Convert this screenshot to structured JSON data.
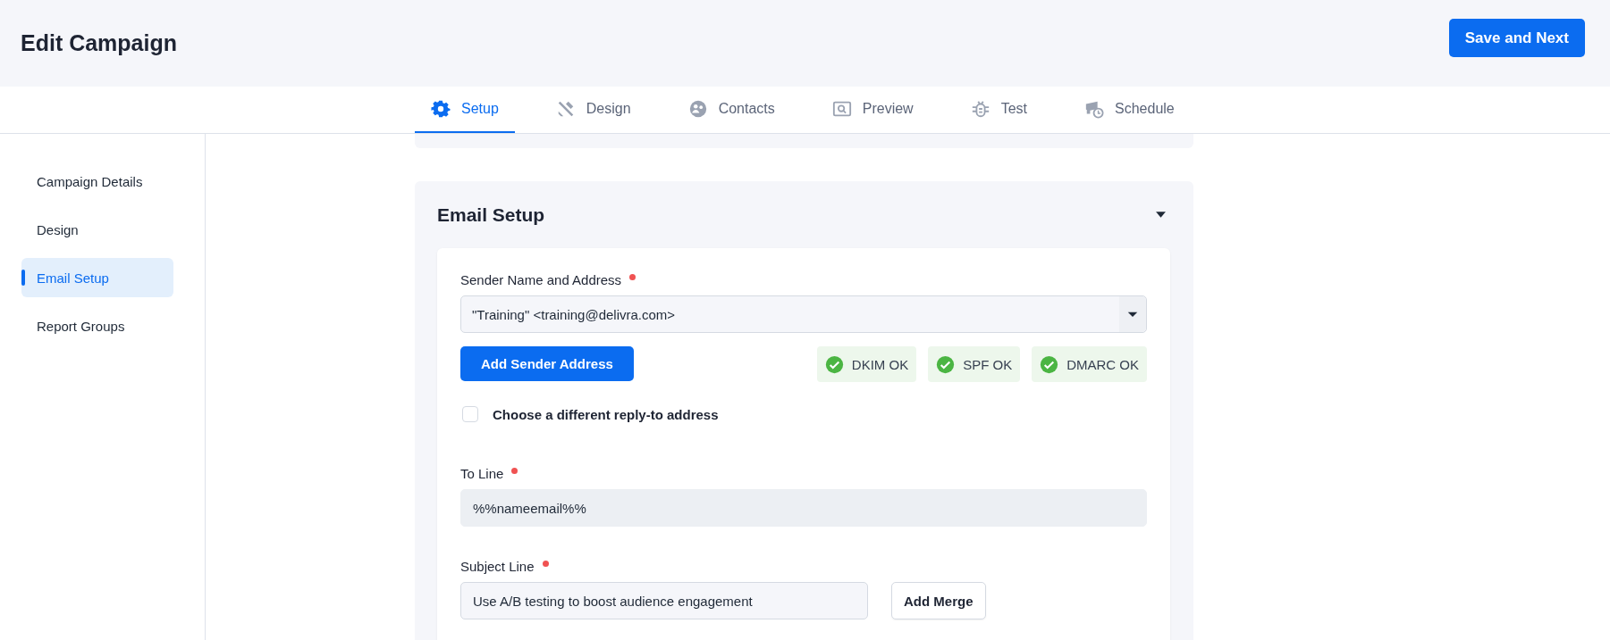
{
  "header": {
    "title": "Edit Campaign",
    "primary_button": "Save and Next"
  },
  "tabs": [
    {
      "label": "Setup",
      "kind": "gear",
      "selected": true
    },
    {
      "label": "Design",
      "kind": "tools",
      "selected": false
    },
    {
      "label": "Contacts",
      "kind": "people",
      "selected": false
    },
    {
      "label": "Preview",
      "kind": "preview",
      "selected": false
    },
    {
      "label": "Test",
      "kind": "bug",
      "selected": false
    },
    {
      "label": "Schedule",
      "kind": "schedule",
      "selected": false
    }
  ],
  "sidebar": {
    "items": [
      {
        "label": "Campaign Details",
        "selected": false
      },
      {
        "label": "Design",
        "selected": false
      },
      {
        "label": "Email Setup",
        "selected": true
      },
      {
        "label": "Report Groups",
        "selected": false
      }
    ]
  },
  "section": {
    "title": "Email Setup",
    "expanded": true,
    "sender": {
      "label": "Sender Name and Address",
      "required": true,
      "value": "\"Training\" <training@delivra.com>",
      "button": "Add Sender Address",
      "badges": [
        {
          "label": "DKIM OK"
        },
        {
          "label": "SPF OK"
        },
        {
          "label": "DMARC OK"
        }
      ]
    },
    "reply_to": {
      "label": "Choose a different reply-to address",
      "checked": false
    },
    "to_line": {
      "label": "To Line",
      "required": true,
      "value": "%%nameemail%%",
      "disabled": true
    },
    "subject_line": {
      "label": "Subject Line",
      "required": true,
      "value": "Use A/B testing to boost audience engagement",
      "disabled": false,
      "button": "Add Merge"
    }
  }
}
